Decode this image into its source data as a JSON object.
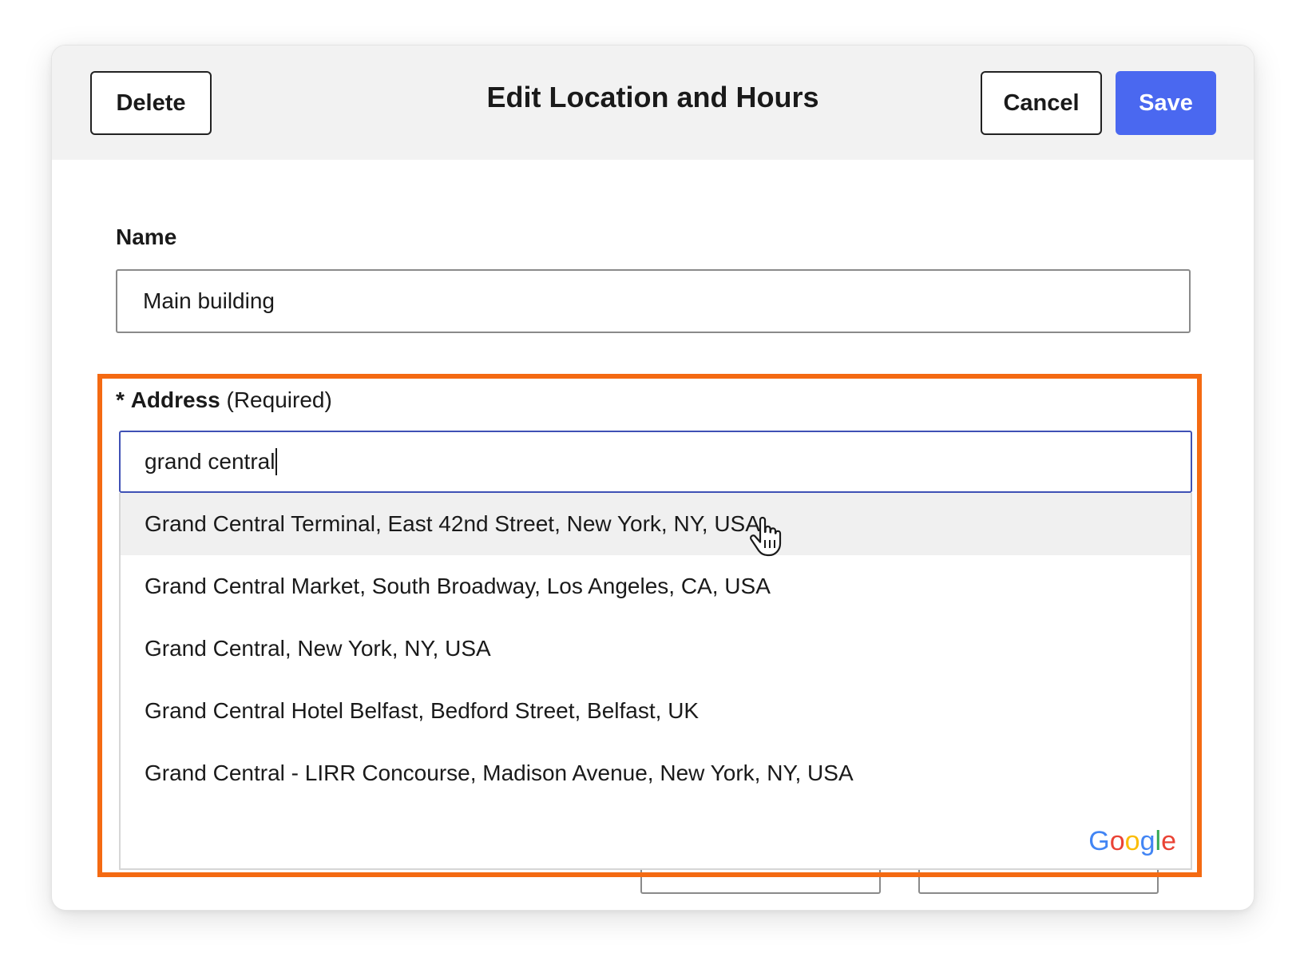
{
  "modal": {
    "title": "Edit Location and Hours",
    "buttons": {
      "delete": "Delete",
      "cancel": "Cancel",
      "save": "Save"
    }
  },
  "form": {
    "name": {
      "label": "Name",
      "value": "Main building"
    },
    "address": {
      "required_mark": "*",
      "label": "Address",
      "qualifier": "(Required)",
      "value": "grand central",
      "suggestions": [
        "Grand Central Terminal, East 42nd Street, New York, NY, USA",
        "Grand Central Market, South Broadway, Los Angeles, CA, USA",
        "Grand Central, New York, NY, USA",
        "Grand Central Hotel Belfast, Bedford Street, Belfast, UK",
        "Grand Central - LIRR Concourse, Madison Avenue, New York, NY, USA"
      ],
      "hovered_index": 0,
      "attribution": [
        "G",
        "o",
        "o",
        "g",
        "l",
        "e"
      ]
    }
  },
  "colors": {
    "primary": "#4a68f0",
    "highlight": "#f46a12",
    "focus_border": "#3f51b5",
    "header_bg": "#f2f2f2"
  },
  "icons": {
    "cursor": "hand-pointer-icon"
  }
}
